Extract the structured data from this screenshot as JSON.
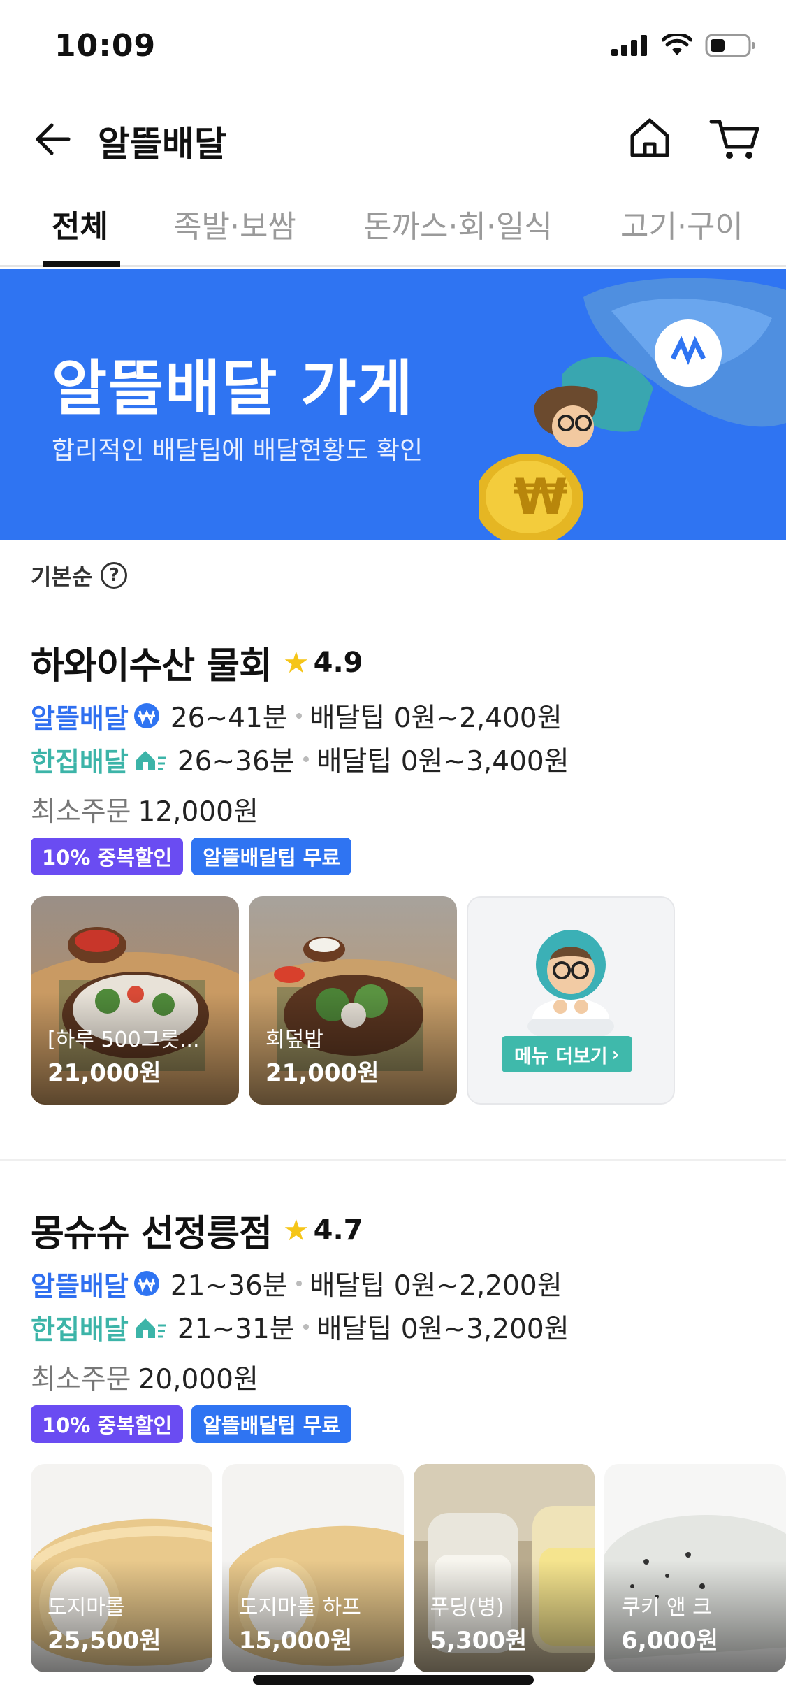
{
  "status": {
    "time": "10:09"
  },
  "header": {
    "title": "알뜰배달"
  },
  "tabs": [
    {
      "label": "전체",
      "active": true
    },
    {
      "label": "족발·보쌈",
      "active": false
    },
    {
      "label": "돈까스·회·일식",
      "active": false
    },
    {
      "label": "고기·구이",
      "active": false
    }
  ],
  "banner": {
    "title": "알뜰배달 가게",
    "subtitle": "합리적인 배달팁에 배달현황도 확인"
  },
  "sort": {
    "label": "기본순",
    "help_glyph": "?"
  },
  "stores": [
    {
      "name": "하와이수산 물회",
      "rating": "4.9",
      "alt": {
        "brand": "알뜰배달",
        "time": "26~41분",
        "tip": "배달팁 0원~2,400원"
      },
      "han": {
        "brand": "한집배달",
        "time": "26~36분",
        "tip": "배달팁 0원~3,400원"
      },
      "min_order_label": "최소주문",
      "min_order_value": "12,000원",
      "badges": [
        "10% 중복할인",
        "알뜰배달팁 무료"
      ],
      "menus": [
        {
          "name": "[하루 500그릇...",
          "price": "21,000원"
        },
        {
          "name": "회덮밥",
          "price": "21,000원"
        }
      ],
      "more_label": "메뉴 더보기"
    },
    {
      "name": "몽슈슈 선정릉점",
      "rating": "4.7",
      "alt": {
        "brand": "알뜰배달",
        "time": "21~36분",
        "tip": "배달팁 0원~2,200원"
      },
      "han": {
        "brand": "한집배달",
        "time": "21~31분",
        "tip": "배달팁 0원~3,200원"
      },
      "min_order_label": "최소주문",
      "min_order_value": "20,000원",
      "badges": [
        "10% 중복할인",
        "알뜰배달팁 무료"
      ],
      "menus": [
        {
          "name": "도지마롤",
          "price": "25,500원"
        },
        {
          "name": "도지마롤 하프",
          "price": "15,000원"
        },
        {
          "name": "푸딩(병)",
          "price": "5,300원"
        },
        {
          "name": "쿠키 앤 크",
          "price": "6,000원"
        }
      ]
    }
  ],
  "colors": {
    "brand_blue": "#2f74f2",
    "discount_purple": "#6a4cf2",
    "hanjib_teal": "#3cb4a8",
    "star": "#f5c518"
  },
  "icons": [
    "back-arrow-icon",
    "home-icon",
    "cart-icon",
    "star-icon",
    "won-badge-icon",
    "house-icon",
    "help-icon",
    "signal-icon",
    "wifi-icon",
    "battery-icon"
  ]
}
